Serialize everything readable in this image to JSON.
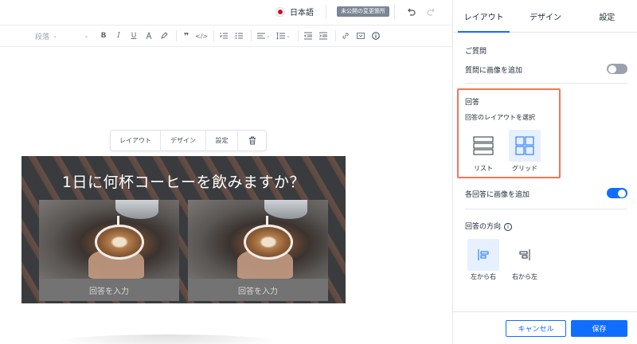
{
  "topbar": {
    "language": "日本語",
    "unpublished_badge": "未公開の変更箇所"
  },
  "toolbar": {
    "paragraph_style": "段落"
  },
  "float_toolbar": {
    "layout": "レイアウト",
    "design": "デザイン",
    "settings": "設定"
  },
  "card": {
    "question": "1日に何杯コーヒーを飲みますか？",
    "answers": [
      {
        "placeholder": "回答を入力"
      },
      {
        "placeholder": "回答を入力"
      }
    ]
  },
  "panel": {
    "tabs": [
      {
        "label": "レイアウト",
        "active": true
      },
      {
        "label": "デザイン",
        "active": false
      },
      {
        "label": "設定",
        "active": false
      }
    ],
    "question_section": {
      "title": "ご質問",
      "add_image_label": "質問に画像を追加",
      "add_image_enabled": false
    },
    "answer_section": {
      "title": "回答",
      "layout_prompt": "回答のレイアウトを選択",
      "options": [
        {
          "label": "リスト",
          "selected": false,
          "icon": "list-layout-icon"
        },
        {
          "label": "グリッド",
          "selected": true,
          "icon": "grid-layout-icon"
        }
      ]
    },
    "answer_image": {
      "label": "各回答に画像を追加",
      "enabled": true
    },
    "direction_section": {
      "title": "回答の方向",
      "info_icon": "info-icon",
      "options": [
        {
          "label": "左から右",
          "selected": true
        },
        {
          "label": "右から左",
          "selected": false
        }
      ]
    },
    "footer": {
      "cancel": "キャンセル",
      "save": "保存"
    }
  },
  "colors": {
    "accent": "#116dff",
    "highlight": "#f0765a",
    "selected_bg": "#e7f0ff"
  }
}
